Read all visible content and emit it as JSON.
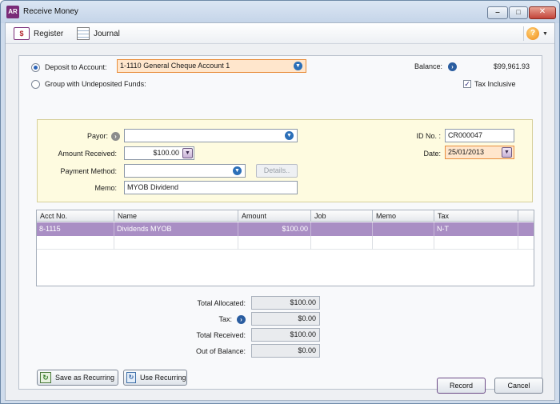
{
  "window": {
    "logo": "AR",
    "title": "Receive Money",
    "minimize": "‒",
    "maximize": "□",
    "close": "✕"
  },
  "toolbar": {
    "register_icon": "$",
    "register_label": "Register",
    "journal_label": "Journal",
    "help_symbol": "?"
  },
  "deposit": {
    "deposit_label": "Deposit to Account:",
    "account_value": "1-1110 General Cheque Account 1",
    "group_label": "Group with Undeposited Funds:",
    "balance_label": "Balance:",
    "balance_value": "$99,961.93",
    "tax_inclusive_label": "Tax Inclusive",
    "tax_inclusive_checked": true
  },
  "info": {
    "payor_label": "Payor:",
    "payor_value": "",
    "amount_label": "Amount Received:",
    "amount_value": "$100.00",
    "payment_method_label": "Payment Method:",
    "payment_method_value": "",
    "details_label": "Details..",
    "memo_label": "Memo:",
    "memo_value": "MYOB Dividend",
    "id_label": "ID No. :",
    "id_value": "CR000047",
    "date_label": "Date:",
    "date_value": "25/01/2013"
  },
  "grid": {
    "columns": [
      "Acct No.",
      "Name",
      "Amount",
      "Job",
      "Memo",
      "Tax"
    ],
    "rows": [
      {
        "acct": "8-1115",
        "name": "Dividends MYOB",
        "amount": "$100.00",
        "job": "",
        "memo": "",
        "tax": "N-T"
      }
    ]
  },
  "totals": {
    "allocated_label": "Total Allocated:",
    "allocated_value": "$100.00",
    "tax_label": "Tax:",
    "tax_value": "$0.00",
    "received_label": "Total Received:",
    "received_value": "$100.00",
    "out_label": "Out of Balance:",
    "out_value": "$0.00"
  },
  "actions": {
    "save_recurring": "Save as Recurring",
    "use_recurring": "Use Recurring",
    "record": "Record",
    "cancel": "Cancel"
  },
  "colors": {
    "selected_row": "#a98ec4",
    "info_box": "#fefbe0",
    "account_highlight": "#ffe6cc"
  }
}
